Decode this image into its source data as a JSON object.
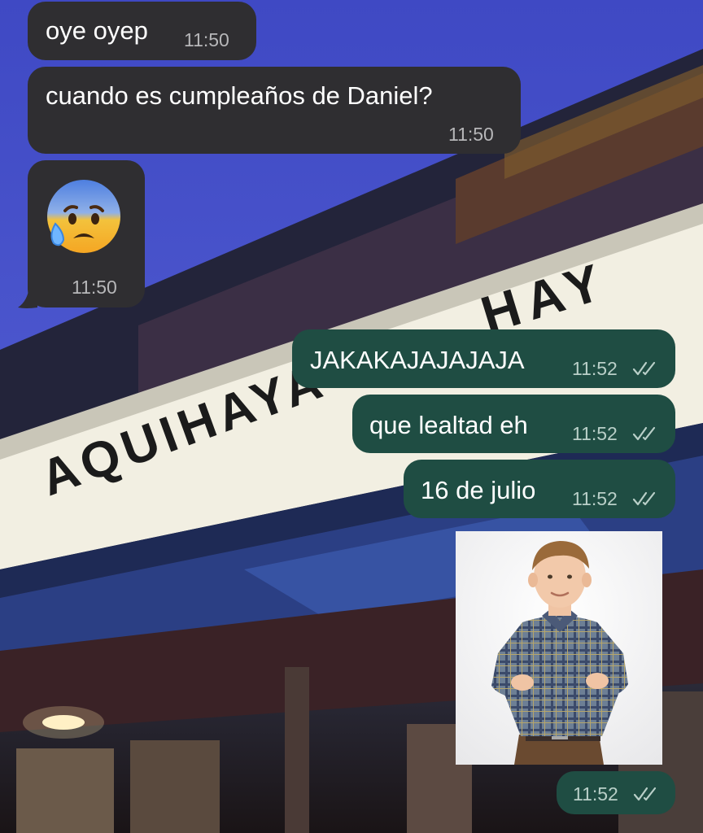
{
  "background": {
    "sign_text": "AQUIHAYAQUIHAY",
    "sign_fragment_left": "AQUIHAYA",
    "sign_fragment_right": "HAY"
  },
  "messages": [
    {
      "direction": "incoming",
      "text": "oye oyep",
      "time": "11:50"
    },
    {
      "direction": "incoming",
      "text": "cuando es cumpleaños de Daniel?",
      "time": "11:50"
    },
    {
      "direction": "incoming",
      "emoji": "anxious-face-with-sweat",
      "time": "11:50"
    },
    {
      "direction": "outgoing",
      "text": "JAKAKAJAJAJAJA",
      "time": "11:52",
      "status": "read"
    },
    {
      "direction": "outgoing",
      "text": "que lealtad eh",
      "time": "11:52",
      "status": "read"
    },
    {
      "direction": "outgoing",
      "text": "16 de julio",
      "time": "11:52",
      "status": "read"
    },
    {
      "direction": "outgoing",
      "image": "boy-arms-crossed-photo",
      "time": "11:52",
      "status": "read"
    }
  ],
  "colors": {
    "incoming_bubble": "#2f2e31",
    "outgoing_bubble": "#1f4d43",
    "sky": "#4451c7"
  }
}
